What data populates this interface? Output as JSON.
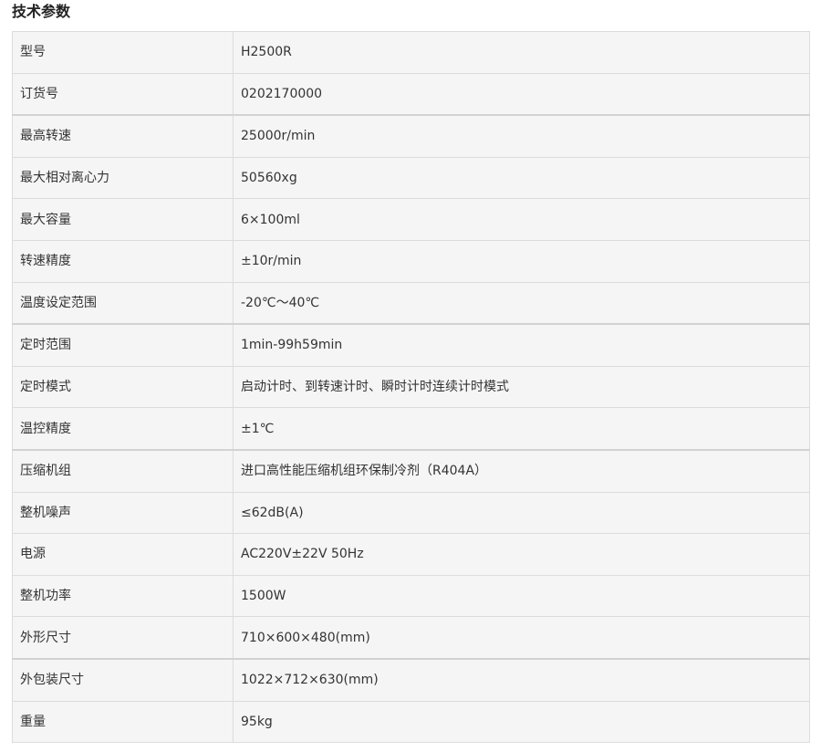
{
  "section": {
    "title": "技术参数"
  },
  "specs": [
    {
      "label": "型号",
      "value": "H2500R"
    },
    {
      "label": "订货号",
      "value": "0202170000"
    },
    {
      "label": "最高转速",
      "value": "25000r/min"
    },
    {
      "label": "最大相对离心力",
      "value": "50560xg"
    },
    {
      "label": "最大容量",
      "value": "6×100ml"
    },
    {
      "label": "转速精度",
      "value": "±10r/min"
    },
    {
      "label": "温度设定范围",
      "value": "-20℃～40℃"
    },
    {
      "label": "定时范围",
      "value": "1min-99h59min"
    },
    {
      "label": "定时模式",
      "value": "启动计时、到转速计时、瞬时计时连续计时模式"
    },
    {
      "label": "温控精度",
      "value": "±1℃"
    },
    {
      "label": "压缩机组",
      "value": "进口高性能压缩机组环保制冷剂（R404A）"
    },
    {
      "label": "整机噪声",
      "value": "≤62dB(A)"
    },
    {
      "label": "电源",
      "value": "AC220V±22V 50Hz"
    },
    {
      "label": "整机功率",
      "value": "1500W"
    },
    {
      "label": "外形尺寸",
      "value": "710×600×480(mm)"
    },
    {
      "label": "外包装尺寸",
      "value": "1022×712×630(mm)"
    },
    {
      "label": "重量",
      "value": "95kg"
    }
  ]
}
